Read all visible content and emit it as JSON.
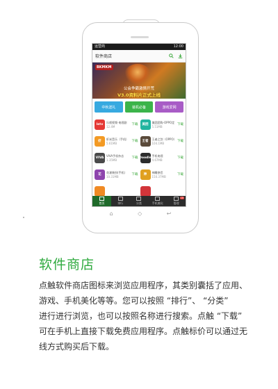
{
  "phone": {
    "status_bar": {
      "carrier": "运营商",
      "time": "12:00"
    },
    "app_bar": {
      "title": "软件商店"
    },
    "banner": {
      "logo": "BKMKM",
      "line1": "公会争霸激情开荒",
      "line2": "V3.0资料片正式上线"
    },
    "categories": [
      {
        "label": "中秋送礼",
        "color": "#37a9e0"
      },
      {
        "label": "装机必备",
        "color": "#3bb44a"
      },
      {
        "label": "游戏爱网",
        "color": "#a85cc6"
      }
    ],
    "apps": [
      {
        "icon_text": "letv",
        "icon_color": "#e53935",
        "name": "乐视视频-电视剧",
        "size": "12.4M",
        "download": "下载"
      },
      {
        "icon_text": "美团",
        "icon_color": "#22b5a0",
        "name": "美团团购-OPPO定",
        "size": "5.51MB",
        "download": "下载"
      },
      {
        "icon_text": "虾",
        "icon_color": "#f39a24",
        "name": "虾米音乐（手机）",
        "size": "5.61MB",
        "download": "下载"
      },
      {
        "icon_text": "王者",
        "icon_color": "#5a4a3a",
        "name": "王者之剑（OPPO）",
        "size": "104.1MB",
        "download": "下载"
      },
      {
        "icon_text": "VIVA",
        "icon_color": "#4a4a4a",
        "name": "VIVA手机杂志",
        "size": "1.35MB",
        "download": "下载"
      },
      {
        "icon_text": "Doodle",
        "icon_color": "#2c2c2c",
        "name": "手机电视",
        "size": "4.67MB",
        "download": "下载"
      },
      {
        "icon_text": "花",
        "icon_color": "#8e44ad",
        "name": "花漾装扮(手机)",
        "size": "10.31MB",
        "download": "下载"
      },
      {
        "icon_text": "神",
        "icon_color": "#e0a020",
        "name": "神雕侠侣",
        "size": "150.37MB",
        "download": "下载"
      },
      {
        "icon_text": "",
        "icon_color": "#f08a24",
        "name": "",
        "size": "",
        "download": ""
      },
      {
        "icon_text": "",
        "icon_color": "#d2353a",
        "name": "",
        "size": "",
        "download": ""
      }
    ],
    "bottom_nav": [
      {
        "label": "首页",
        "active": true
      },
      {
        "label": "排行"
      },
      {
        "label": "分类"
      },
      {
        "label": "手机美化"
      },
      {
        "label": "管理",
        "badge": "10"
      }
    ],
    "hw_keys": [
      "⌂",
      "◇",
      "↩"
    ]
  },
  "section": {
    "title": "软件商店",
    "lines": [
      "点触软件商店图标来浏览应用程序，其类别囊括了应用、",
      "游戏、手机美化等等。您可以按照 “排行”、 “分类”",
      "进行进行浏览，也可以按照名称进行搜索。点触 “下载”",
      "可在手机上直接下载免费应用程序。点触标价可以通过无",
      "线方式购买后下载。"
    ]
  },
  "colors": {
    "accent": "#2faa3f",
    "text": "#333333"
  }
}
